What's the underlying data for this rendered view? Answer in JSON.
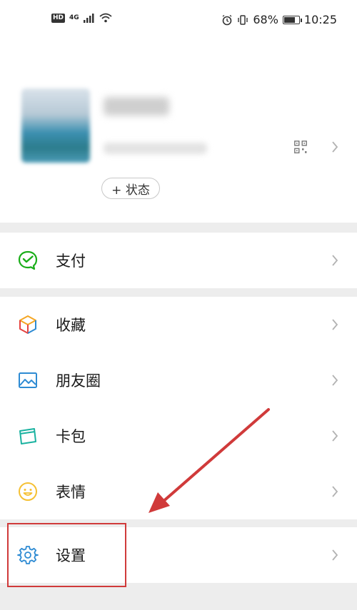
{
  "status_bar": {
    "left_badges": [
      "HD",
      "4G"
    ],
    "battery": "68%",
    "battery_level": 0.68,
    "time": "10:25"
  },
  "profile": {
    "status_button_label": "+ 状态"
  },
  "menu": {
    "group1": [
      {
        "label": "支付",
        "icon": "wechat-pay-icon"
      }
    ],
    "group2": [
      {
        "label": "收藏",
        "icon": "favorites-cube-icon"
      },
      {
        "label": "朋友圈",
        "icon": "moments-image-icon"
      },
      {
        "label": "卡包",
        "icon": "card-wallet-icon"
      },
      {
        "label": "表情",
        "icon": "sticker-smile-icon"
      }
    ],
    "group3": [
      {
        "label": "设置",
        "icon": "settings-gear-icon"
      }
    ]
  },
  "colors": {
    "pay_green": "#1aad19",
    "gear_blue": "#2e8bd3",
    "annotation_red": "#d03a3a"
  }
}
